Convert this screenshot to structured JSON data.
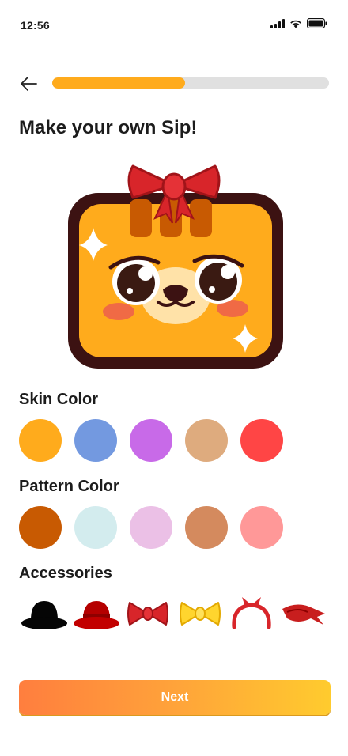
{
  "status": {
    "time": "12:56",
    "icons": [
      "signal-icon",
      "wifi-icon",
      "battery-icon"
    ]
  },
  "nav": {
    "back_icon": "arrow-left-icon",
    "progress_fraction": 0.48
  },
  "title": "Make your own Sip!",
  "avatar": {
    "name": "sip-avatar",
    "accessory": "red-bow"
  },
  "skin": {
    "label": "Skin Color",
    "colors": [
      "#FFAB1C",
      "#7399E0",
      "#C86AE8",
      "#DEAB7E",
      "#FF4545"
    ]
  },
  "pattern": {
    "label": "Pattern Color",
    "colors": [
      "#C85A02",
      "#D3ECEE",
      "#EBC0E6",
      "#D48A5E",
      "#FF9898"
    ]
  },
  "accessories": {
    "label": "Accessories",
    "items": [
      "black-bowler-hat-icon",
      "red-bowler-hat-icon",
      "red-bow-icon",
      "yellow-bow-icon",
      "red-headband-icon",
      "red-bandana-icon"
    ]
  },
  "colors": {
    "accent": "#FFAB1C",
    "outline": "#3C1212",
    "button_start": "#FF7E3E",
    "button_end": "#FFCB2E"
  },
  "next_button": {
    "label": "Next"
  }
}
